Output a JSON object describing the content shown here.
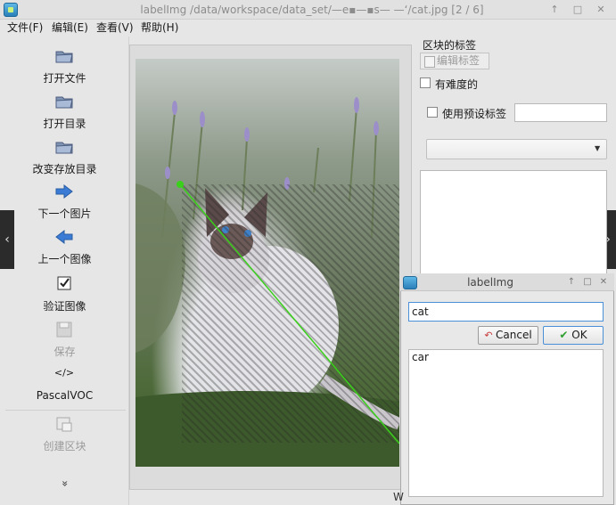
{
  "window": {
    "title": "labelImg /data/workspace/data_set/—e▪—▪s— —‘/cat.jpg [2 / 6]",
    "buttons": [
      "↑",
      "□",
      "✕"
    ]
  },
  "menu": {
    "items": [
      "文件(F)",
      "编辑(E)",
      "查看(V)",
      "帮助(H)"
    ]
  },
  "toolbar": {
    "open_file": "打开文件",
    "open_dir": "打开目录",
    "change_save_dir": "改变存放目录",
    "next_image": "下一个图片",
    "prev_image": "上一个图像",
    "verify": "验证图像",
    "save": "保存",
    "format_icon": "</>",
    "format": "PascalVOC",
    "create_box": "创建区块",
    "more": "»"
  },
  "dock": {
    "title": "区块的标签",
    "edit_label_button": "编辑标签",
    "difficult": "有难度的",
    "use_default_label": "使用预设标签",
    "default_label_value": ""
  },
  "dialog": {
    "title": "labelImg",
    "buttons": [
      "↑",
      "□",
      "✕"
    ],
    "input_value": "cat",
    "cancel": "Cancel",
    "ok": "OK",
    "label_options": [
      "car"
    ]
  },
  "status": {
    "glyph": "W"
  },
  "scroll_arrows": {
    "left": "‹",
    "right": "›"
  },
  "colors": {
    "bbox_hatch": "#2c2c2c",
    "annotation_line": "#39d11a",
    "icon_blue": "#3a7bd5",
    "dialog_focus": "#4a90d9"
  }
}
